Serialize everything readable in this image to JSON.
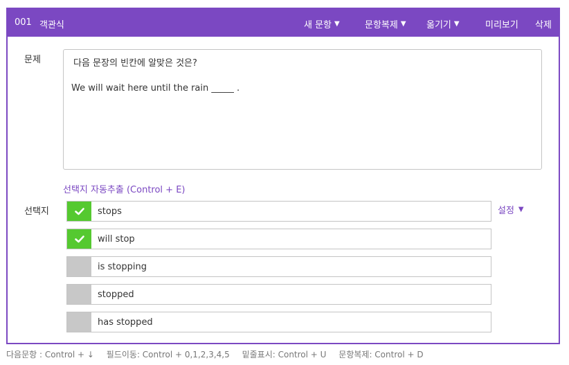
{
  "header": {
    "number": "001",
    "type": "객관식",
    "menu": {
      "new_question": "새 문항",
      "duplicate": "문항복제",
      "move": "옮기기",
      "preview": "미리보기",
      "delete": "삭제"
    }
  },
  "question": {
    "label": "문제",
    "line1": "다음 문장의 빈칸에 알맞은 것은?",
    "line2": "We will wait here until the rain _____ ."
  },
  "auto_extract_label": "선택지 자동추출 (Control + E)",
  "choices": {
    "label": "선택지",
    "settings_label": "설정",
    "items": [
      {
        "text": "stops",
        "checked": true
      },
      {
        "text": "will stop",
        "checked": true
      },
      {
        "text": "is stopping",
        "checked": false
      },
      {
        "text": "stopped",
        "checked": false
      },
      {
        "text": "has stopped",
        "checked": false
      }
    ]
  },
  "shortcuts": [
    "다음문항 : Control + ↓",
    "필드이동: Control + 0,1,2,3,4,5",
    "밑줄표시: Control + U",
    "문항복제: Control + D"
  ],
  "colors": {
    "accent": "#7b48c2",
    "checked": "#55c930",
    "unchecked": "#c8c8c8"
  }
}
